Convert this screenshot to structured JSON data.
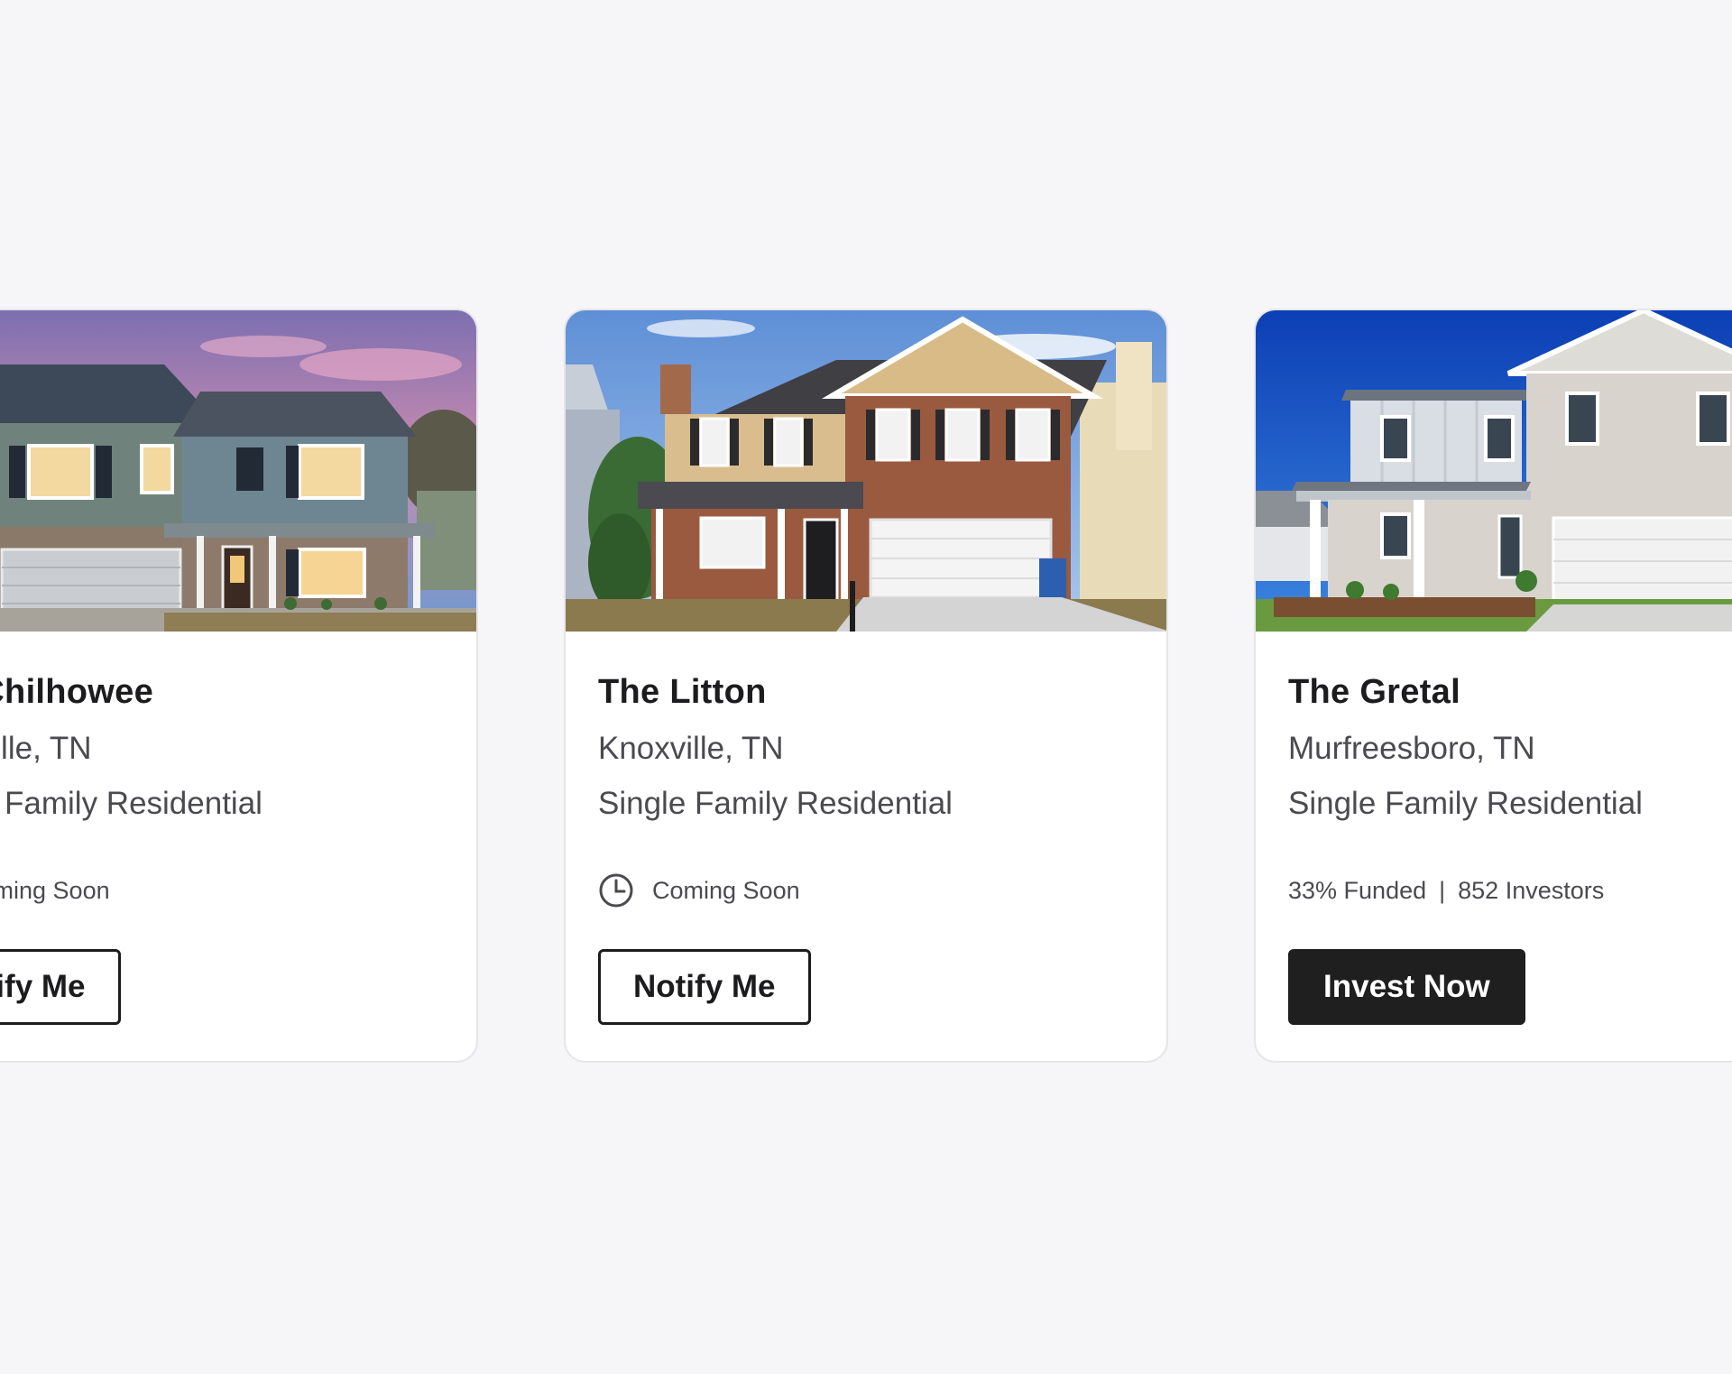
{
  "properties": [
    {
      "name": "The Chilhowee",
      "location": "Maryville, TN",
      "type": "Single Family Residential",
      "status": "Coming Soon",
      "status_icon": "clock-icon",
      "button_label": "Notify Me"
    },
    {
      "name": "The Litton",
      "location": "Knoxville, TN",
      "type": "Single Family Residential",
      "status": "Coming Soon",
      "status_icon": "clock-icon",
      "button_label": "Notify Me"
    },
    {
      "name": "The Gretal",
      "location": "Murfreesboro, TN",
      "type": "Single Family Residential",
      "funded": "33% Funded",
      "separator": "|",
      "investors": "852 Investors",
      "button_label": "Invest Now"
    }
  ],
  "colors": {
    "page_background": "#f6f6f8",
    "card_background": "#ffffff",
    "primary_button": "#1f1f1f",
    "text_primary": "#1c1c1e",
    "text_secondary": "#4a4a4f"
  }
}
